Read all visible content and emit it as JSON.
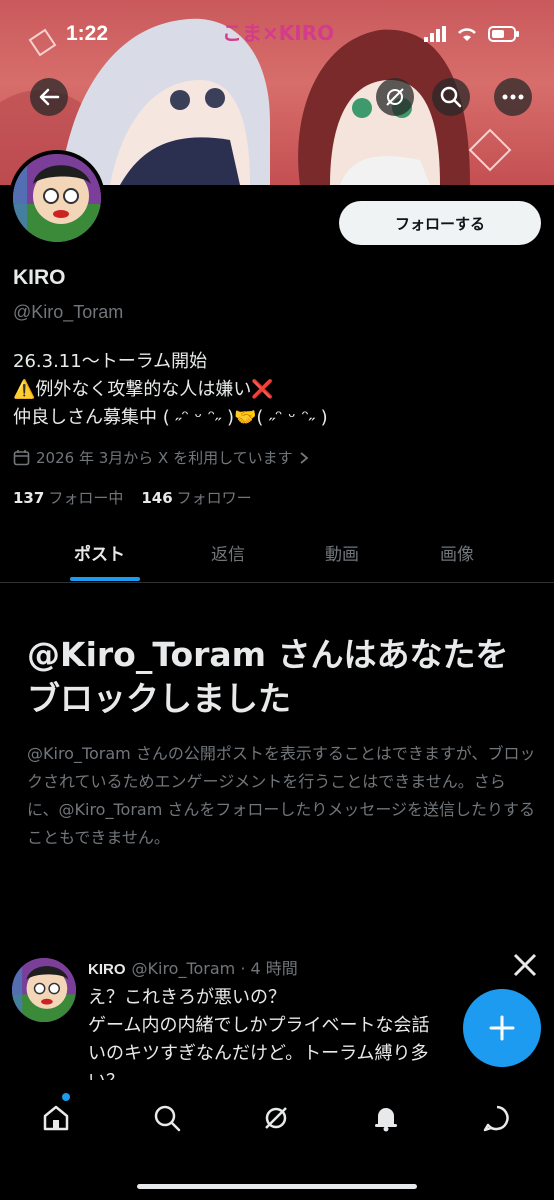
{
  "status_bar": {
    "time": "1:22"
  },
  "banner": {
    "text": "こま×KIRO"
  },
  "profile": {
    "follow_label": "フォローする",
    "name": "KIRO",
    "handle": "@Kiro_Toram",
    "bio": [
      "26.3.11～トーラム開始",
      "⚠️例外なく攻撃的な人は嫌い❌",
      "仲良しさん募集中 ( ˶ᵔ ᵕ ᵔ˶ )🤝( ˶ᵔ ᵕ ᵔ˶ )"
    ],
    "joined": "2026 年 3月から X を利用しています",
    "following_count": "137",
    "following_label": "フォロー中",
    "followers_count": "146",
    "followers_label": "フォロワー"
  },
  "tabs": [
    "ポスト",
    "返信",
    "動画",
    "画像"
  ],
  "blocked": {
    "title": "@Kiro_Toram さんはあなたをブロックしました",
    "description": "@Kiro_Toram さんの公開ポストを表示することはできますが、ブロックされているためエンゲージメントを行うことはできません。さらに、@Kiro_Toram さんをフォローしたりメッセージを送信したりすることもできません。"
  },
  "tweet": {
    "name": "KIRO",
    "handle_time": "@Kiro_Toram · 4 時間",
    "lines": [
      "え？これきろが悪いの？",
      "ゲーム内の内緒でしかプライベートな会話",
      "いのキツすぎなんだけど。トーラム縛り多",
      "い？"
    ]
  },
  "colors": {
    "accent": "#1d9bf0",
    "muted": "#71767b",
    "text": "#e7e9ea"
  },
  "icons": [
    "back-arrow-icon",
    "grok-icon",
    "search-icon",
    "more-icon",
    "calendar-icon",
    "x-logo-icon",
    "plus-icon",
    "home-icon",
    "explore-icon",
    "notifications-icon",
    "messages-icon"
  ]
}
